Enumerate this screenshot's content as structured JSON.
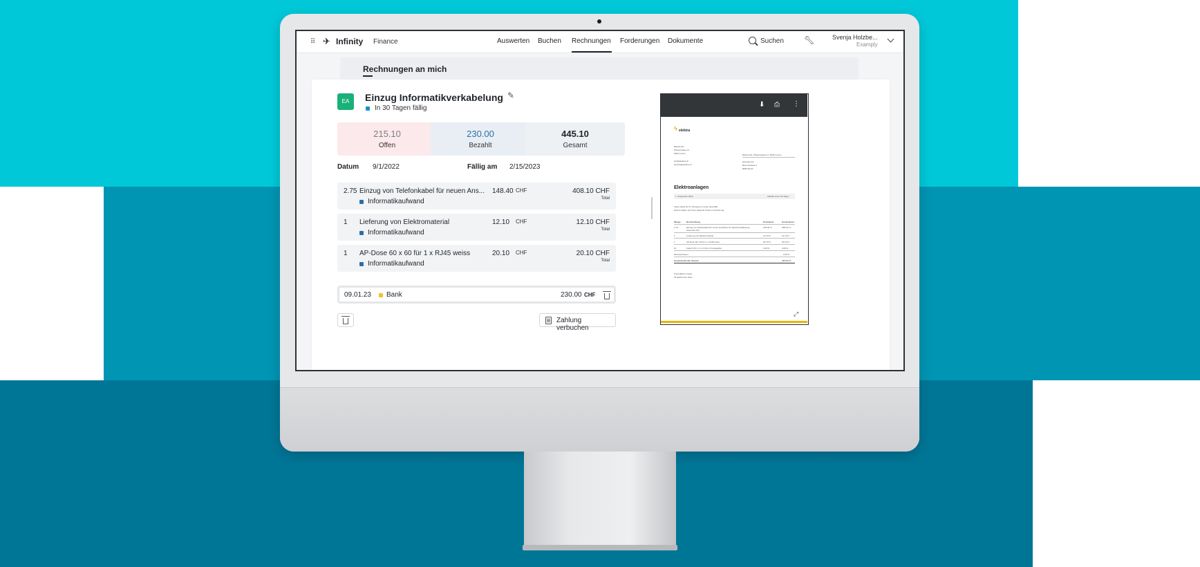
{
  "nav": {
    "app_name": "Infinity",
    "module": "Finance",
    "tabs": [
      {
        "label": "Auswerten"
      },
      {
        "label": "Buchen"
      },
      {
        "label": "Rechnungen"
      },
      {
        "label": "Forderungen"
      },
      {
        "label": "Dokumente"
      }
    ],
    "active_tab": "Rechnungen",
    "search_label": "Suchen",
    "user_name": "Svenja Holzbe...",
    "user_company": "Examply"
  },
  "section_heading": "Rechnungen an mich",
  "invoice": {
    "avatar": "EA",
    "title": "Einzug Informatikverkabelung",
    "status": "In 30 Tagen fällig",
    "summary": [
      {
        "amount": "215.10",
        "label": "Offen"
      },
      {
        "amount": "230.00",
        "label": "Bezahlt"
      },
      {
        "amount": "445.10",
        "label": "Gesamt"
      }
    ],
    "date_label": "Datum",
    "date": "9/1/2022",
    "due_label": "Fällig am",
    "due": "2/15/2023",
    "lines": [
      {
        "qty": "2.75",
        "desc": "Einzug von Telefonkabel für neuen Ans...",
        "price": "148.40",
        "currency": "CHF",
        "total": "408.10 CHF",
        "total_label": "Total",
        "category": "Informatikaufwand"
      },
      {
        "qty": "1",
        "desc": "Lieferung von Elektromaterial",
        "price": "12.10",
        "currency": "CHF",
        "total": "12.10 CHF",
        "total_label": "Total",
        "category": "Informatikaufwand"
      },
      {
        "qty": "1",
        "desc": "AP-Dose 60 x 60 für 1 x RJ45 weiss",
        "price": "20.10",
        "currency": "CHF",
        "total": "20.10 CHF",
        "total_label": "Total",
        "category": "Informatikaufwand"
      }
    ],
    "payment": {
      "date": "09.01.23",
      "account": "Bank",
      "amount": "230.00",
      "currency": "CHF"
    },
    "book_button": "Zahlung verbuchen"
  },
  "pdf": {
    "logo": "elektra",
    "sender": [
      "Elektra AG",
      "Pfisterstrasse 11",
      "6003 Luzern"
    ],
    "contact": [
      "info@elektra.ch",
      "finance@elektra.ch"
    ],
    "return_line": "Elektra AG, Pfisterstrasse 11, 6003 Luzern",
    "recipient": [
      "Examply AG",
      "Bernerstrasse 1",
      "8085 Zürich"
    ],
    "heading": "Elektroanlagen",
    "date_line": "1. September 2022",
    "terms": "Zahlbar innert 30 Tagen",
    "intro": [
      "Vielen Dank für Ihr Vertrauen in unser Geschäft.",
      "Hiermit stellen wir Ihnen folgende Posten in Rechnung:"
    ],
    "columns": [
      "Menge",
      "Beschreibung",
      "Einzelpreis",
      "Gesamtpreis"
    ],
    "rows": [
      [
        "2.75",
        "Einzug von Telefonkabel für neuen Anschluss für Telefonverkabelung, Telemeter-NO",
        "148.40 Fr.",
        "408.10 Fr."
      ],
      [
        "1",
        "Lieferung von Elektromaterial",
        "12.10 Fr.",
        "12.10 Fr."
      ],
      [
        "1",
        "AP-Dose 60 x 60 für 1 x RJ45 weiss",
        "20.10 Fr.",
        "20.10 Fr."
      ],
      [
        "10",
        "Kabel U72 1 x 4 x 0,5mm² hamagefliet",
        "0.48 Fr.",
        "4.80 Fr."
      ]
    ],
    "vat_label": "Mehrwertsteuer",
    "vat": "0.00 Fr.",
    "grand_total_label": "Gesamttotal inkl. Steuern",
    "grand_total": "445.10 Fr.",
    "closing": [
      "Freundliche Grüsse,",
      "Ihr Elektra AG Team"
    ]
  }
}
